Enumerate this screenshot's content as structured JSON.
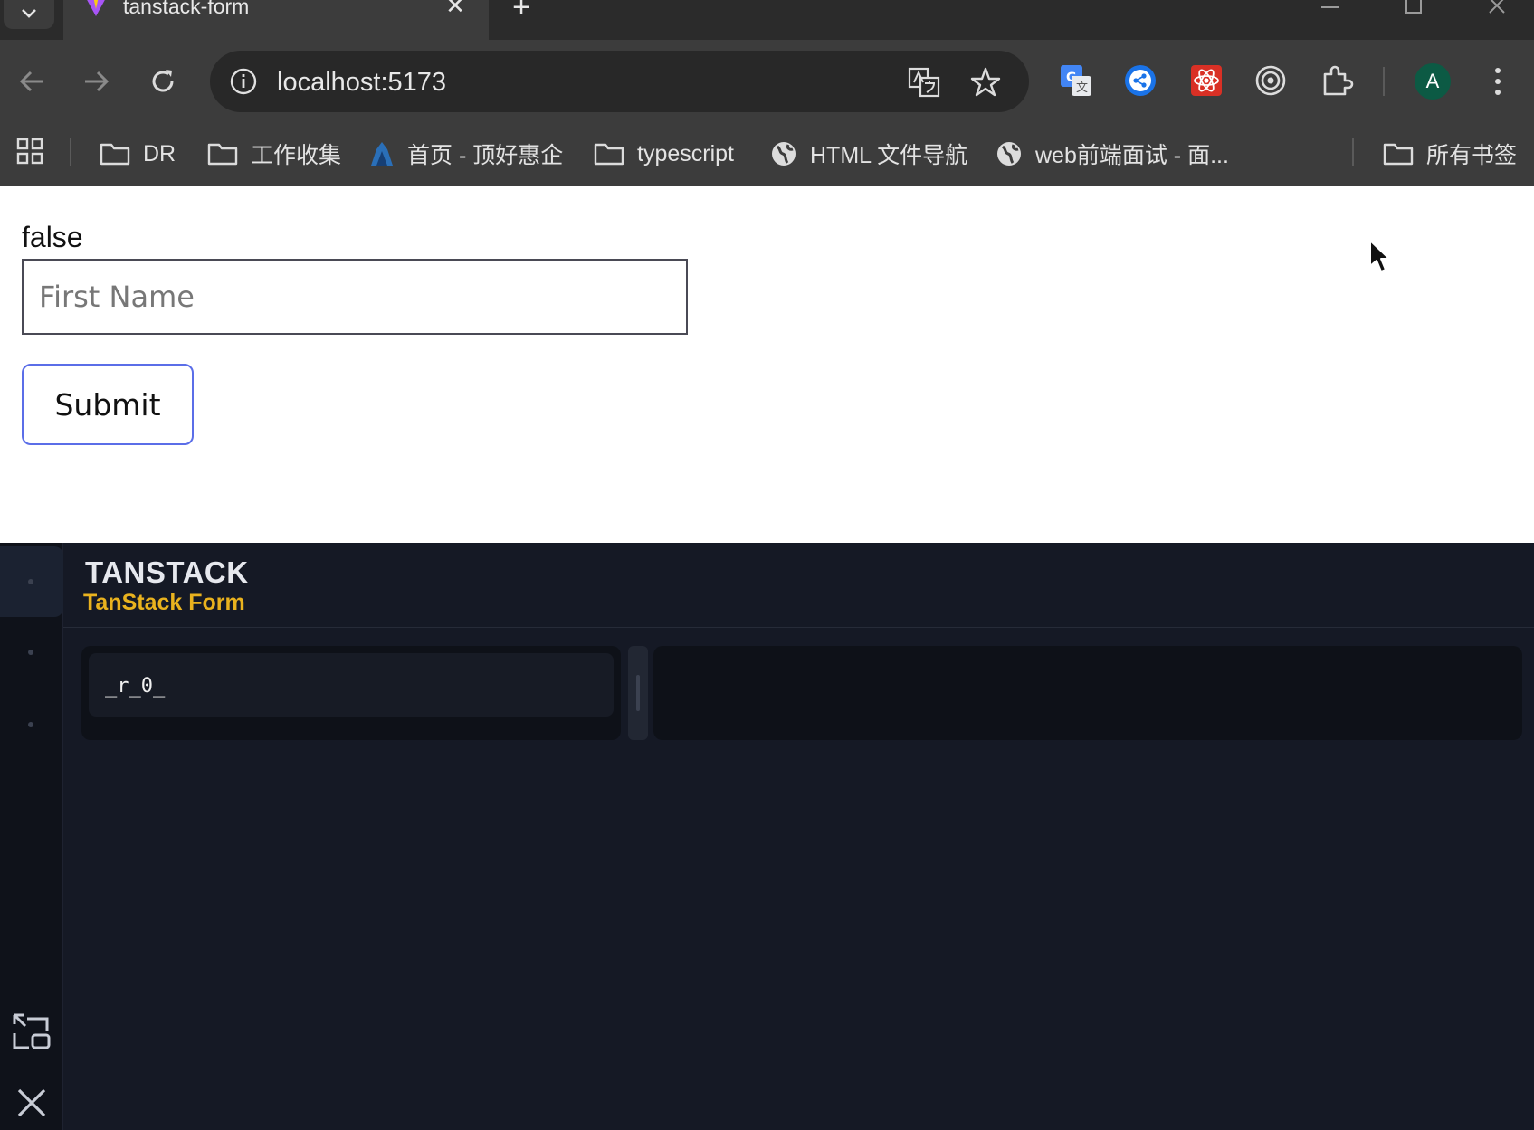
{
  "browser": {
    "tab": {
      "title": "tanstack-form"
    },
    "address": {
      "url": "localhost:5173"
    },
    "profile": {
      "initial": "A"
    },
    "bookmarks": [
      {
        "label": "DR"
      },
      {
        "label": "工作收集"
      },
      {
        "label": "首页 - 顶好惠企"
      },
      {
        "label": "typescript"
      },
      {
        "label": "HTML 文件导航"
      },
      {
        "label": "web前端面试 - 面..."
      }
    ],
    "all_bookmarks": "所有书签"
  },
  "page": {
    "state_text": "false",
    "first_name_placeholder": "First Name",
    "submit_label": "Submit"
  },
  "devtools": {
    "brand": "TANSTACK",
    "subtitle": "TanStack Form",
    "forms": [
      {
        "id": "_r_0_"
      }
    ]
  }
}
